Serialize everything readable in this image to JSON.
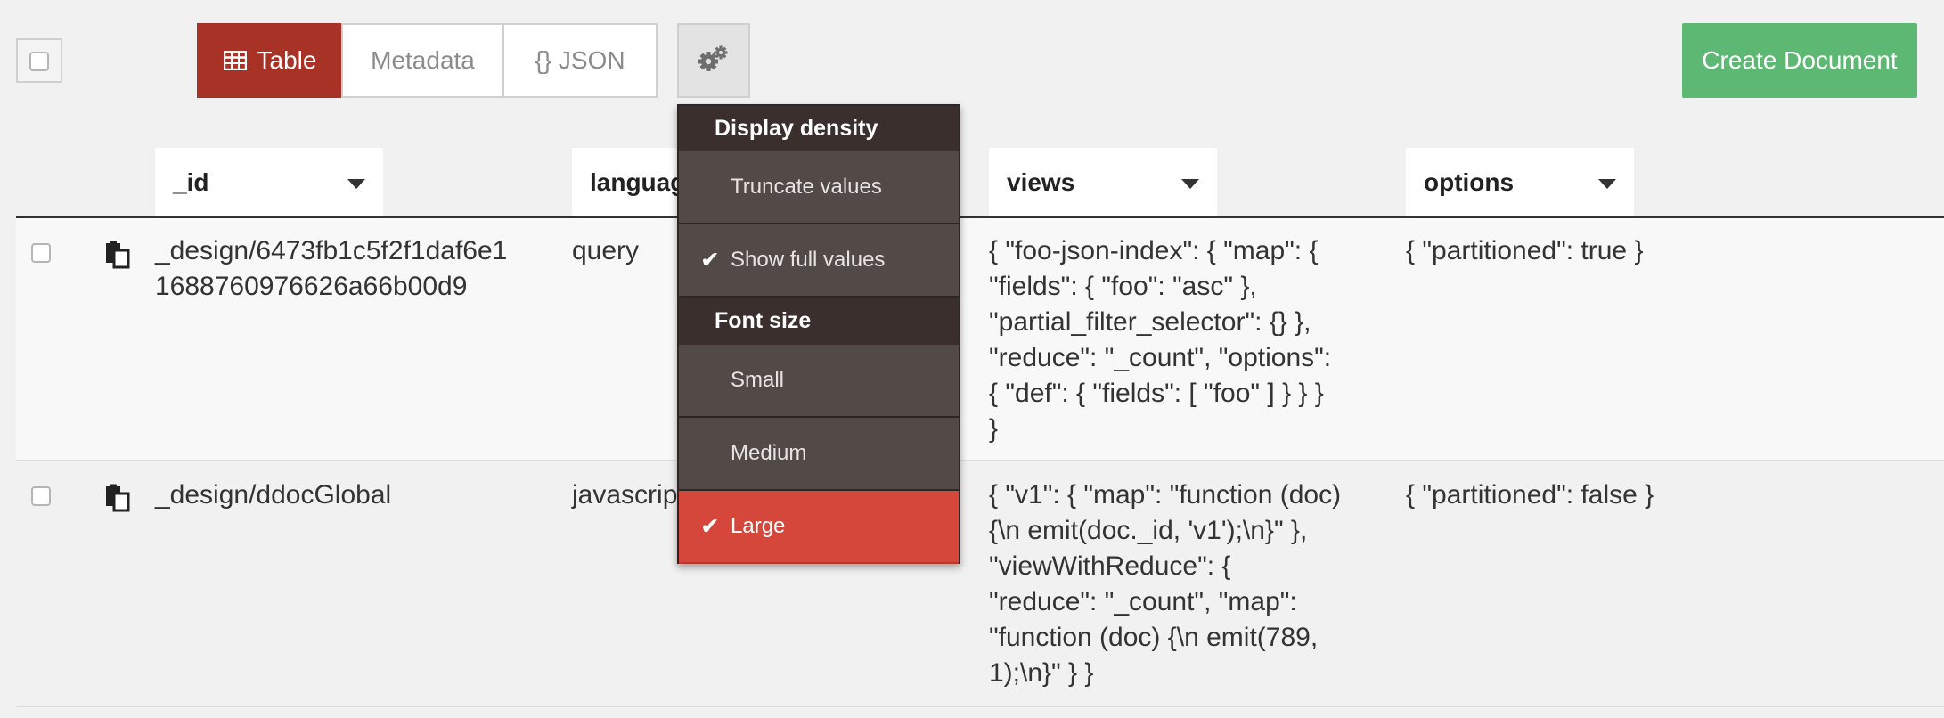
{
  "toolbar": {
    "view_tabs": [
      {
        "label": "Table",
        "icon": "table-icon",
        "active": true
      },
      {
        "label": "Metadata",
        "active": false
      },
      {
        "label": "{} JSON",
        "active": false
      }
    ],
    "settings_icon": "gears-icon",
    "create_label": "Create Document"
  },
  "columns": [
    {
      "label": "_id"
    },
    {
      "label": "language"
    },
    {
      "label": "views"
    },
    {
      "label": "options"
    }
  ],
  "rows": [
    {
      "id_lines": [
        "_design/6473fb1c5f2f1daf6e1",
        "1688760976626a66b00d9"
      ],
      "language": "query",
      "views_lines": [
        "{ \"foo-json-index\": { \"map\": {",
        "\"fields\": { \"foo\": \"asc\" },",
        "\"partial_filter_selector\": {} },",
        "\"reduce\": \"_count\", \"options\":",
        "{ \"def\": { \"fields\": [ \"foo\" ] } } }",
        "}"
      ],
      "options": "{ \"partitioned\": true }"
    },
    {
      "id_lines": [
        "_design/ddocGlobal"
      ],
      "language": "javascript",
      "views_lines": [
        "{ \"v1\": { \"map\": \"function (doc)",
        "{\\n emit(doc._id, 'v1');\\n}\" },",
        "\"viewWithReduce\": {",
        "\"reduce\": \"_count\", \"map\":",
        "\"function (doc) {\\n emit(789,",
        "1);\\n}\" } }"
      ],
      "options": "{ \"partitioned\": false }"
    }
  ],
  "menu": {
    "density_header": "Display density",
    "truncate_label": "Truncate values",
    "full_label": "Show full values",
    "full_checked": true,
    "font_header": "Font size",
    "small_label": "Small",
    "medium_label": "Medium",
    "large_label": "Large",
    "large_checked": true
  },
  "colors": {
    "active_tab": "#a93226",
    "create_button": "#5cb872",
    "menu_active": "#d4473a",
    "menu_bg": "#524a47"
  }
}
